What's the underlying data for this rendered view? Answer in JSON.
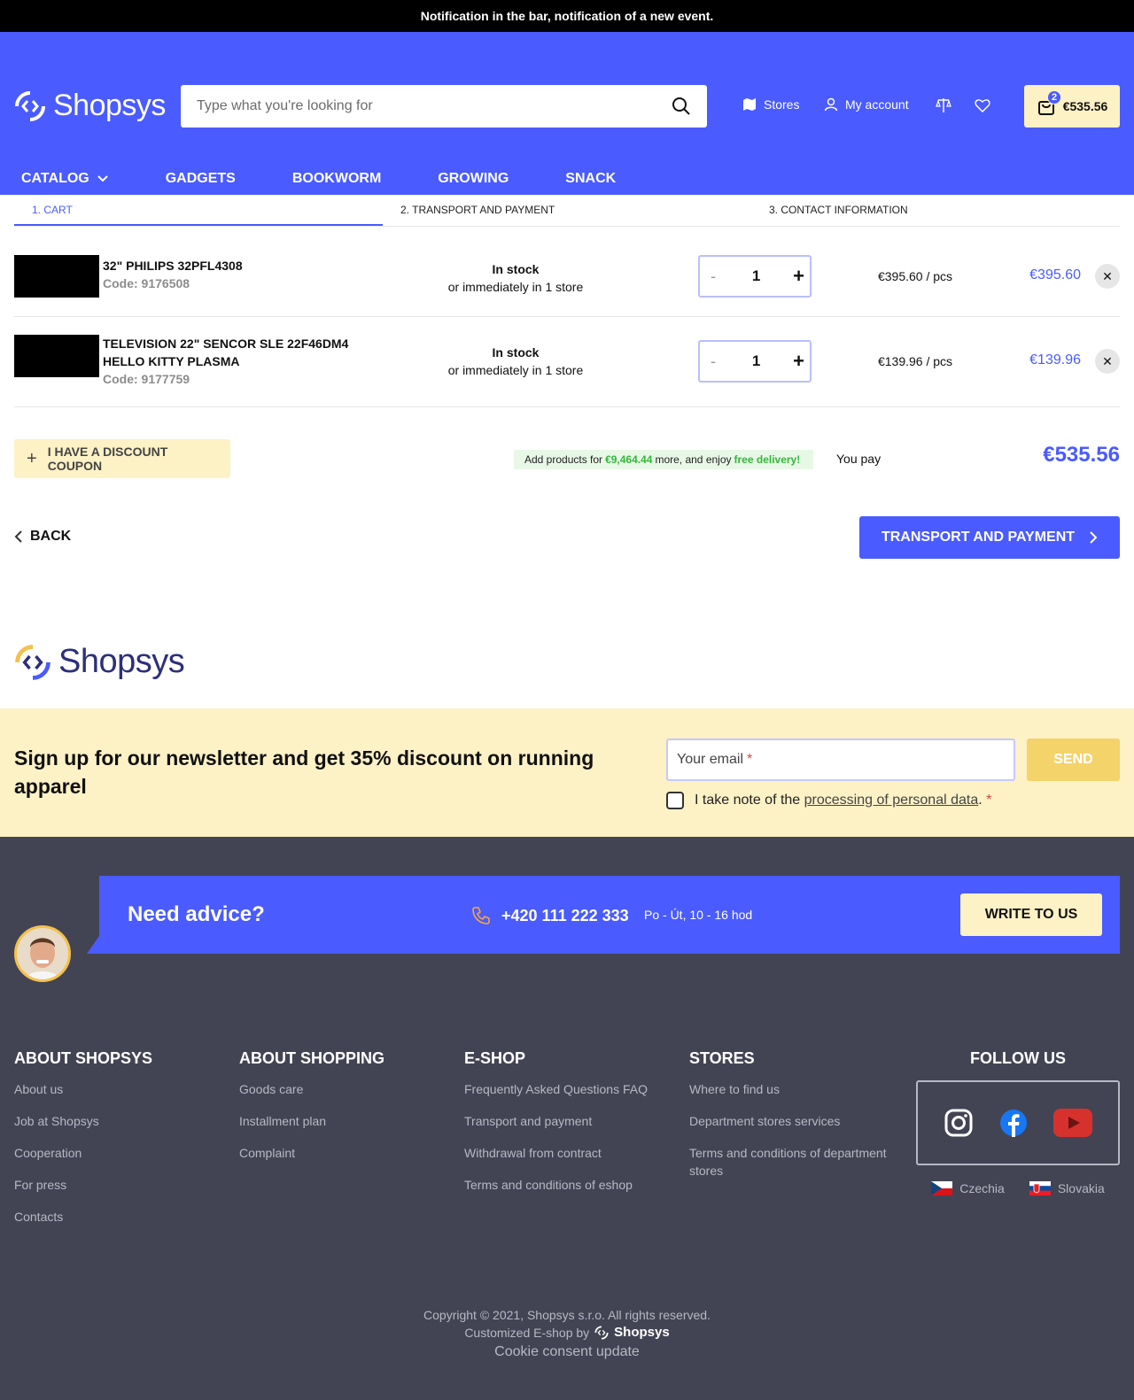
{
  "notification": "Notification in the bar, notification of a new event.",
  "header": {
    "logo": "Shopsys",
    "search_placeholder": "Type what you're looking for",
    "stores": "Stores",
    "account": "My account",
    "cart_count": "2",
    "cart_total": "€535.56"
  },
  "nav": [
    "CATALOG",
    "GADGETS",
    "BOOKWORM",
    "GROWING",
    "SNACK"
  ],
  "steps": [
    "1. CART",
    "2. TRANSPORT AND PAYMENT",
    "3. CONTACT INFORMATION"
  ],
  "items": [
    {
      "name": "32\" PHILIPS 32PFL4308",
      "name2": "",
      "code": "Code: 9176508",
      "stock": "In stock",
      "stock_sub": "or immediately in 1 store",
      "qty": "1",
      "unit": "€395.60 / pcs",
      "total": "€395.60"
    },
    {
      "name": "TELEVISION 22\" SENCOR SLE 22F46DM4",
      "name2": "HELLO KITTY PLASMA",
      "code": "Code: 9177759",
      "stock": "In stock",
      "stock_sub": "or immediately in 1 store",
      "qty": "1",
      "unit": "€139.96 / pcs",
      "total": "€139.96"
    }
  ],
  "summary": {
    "coupon": "I HAVE A DISCOUNT COUPON",
    "free_pre": "Add products for",
    "free_amount": "€9,464.44",
    "free_mid": "more, and enjoy",
    "free_end": "free delivery!",
    "you_pay": "You pay",
    "total": "€535.56",
    "back": "BACK",
    "next": "TRANSPORT AND PAYMENT"
  },
  "newsletter": {
    "title": "Sign up for our newsletter and get 35% discount on running apparel",
    "email_placeholder": "Your email",
    "send": "SEND",
    "consent_pre": "I take note of the",
    "consent_link": "processing of personal data",
    "consent_post": "."
  },
  "advice": {
    "title": "Need advice?",
    "phone": "+420 111 222 333",
    "hours": "Po - Út, 10 - 16 hod",
    "write": "WRITE TO US"
  },
  "footer": {
    "columns": [
      {
        "title": "ABOUT SHOPSYS",
        "links": [
          "About us",
          "Job at Shopsys",
          "Cooperation",
          "For press",
          "Contacts"
        ]
      },
      {
        "title": "ABOUT SHOPPING",
        "links": [
          "Goods care",
          "Installment plan",
          "Complaint"
        ]
      },
      {
        "title": "E-SHOP",
        "links": [
          "Frequently Asked Questions FAQ",
          "Transport and payment",
          "Withdrawal from contract",
          "Terms and conditions of eshop"
        ]
      },
      {
        "title": "STORES",
        "links": [
          "Where to find us",
          "Department stores services",
          "Terms and conditions of department stores"
        ]
      }
    ],
    "follow": "FOLLOW US",
    "langs": [
      "Czechia",
      "Slovakia"
    ],
    "copyright": "Copyright © 2021, Shopsys s.r.o. All rights reserved.",
    "customized": "Customized E-shop by",
    "brand": "Shopsys",
    "cookie": "Cookie consent update"
  },
  "colors": {
    "brand": "#4a5bff",
    "accent": "#fdf1c6",
    "dark": "#434453"
  }
}
